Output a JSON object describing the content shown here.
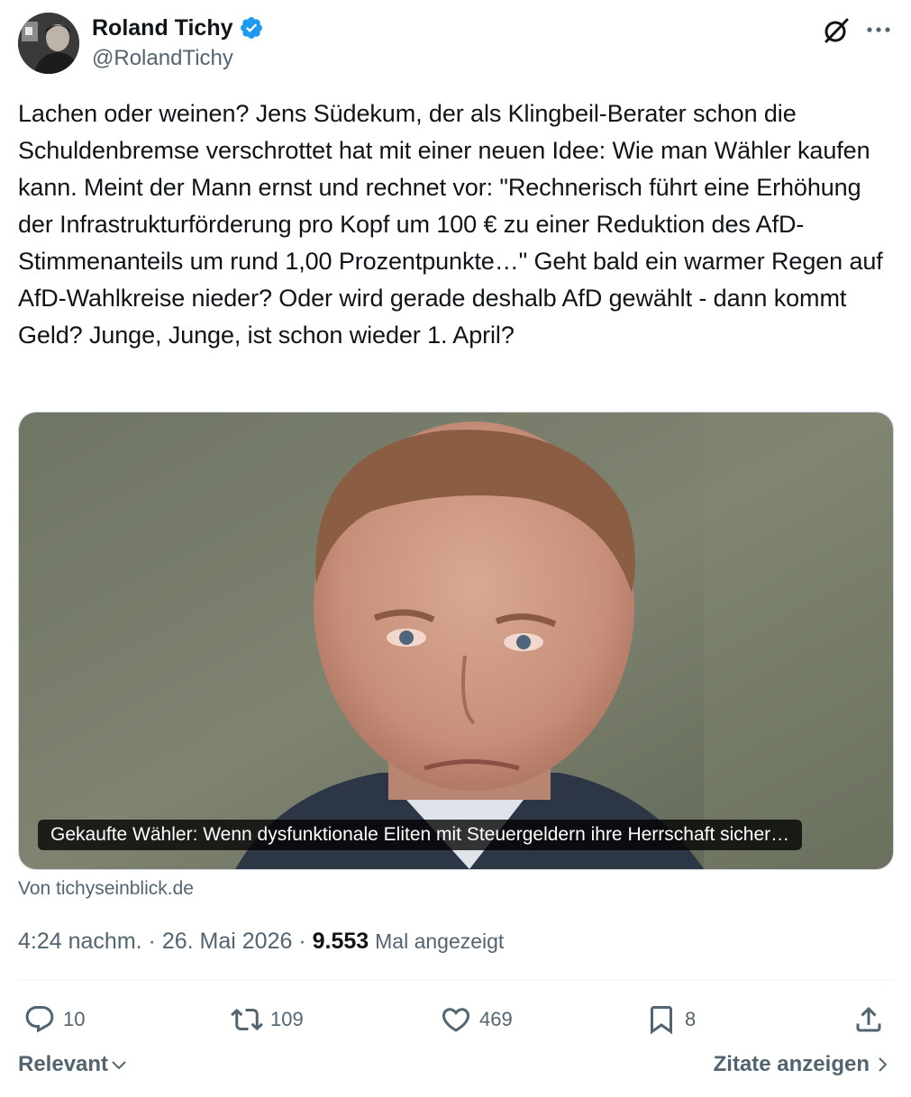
{
  "author": {
    "name": "Roland Tichy",
    "handle": "@RolandTichy",
    "verified_color": "#1d9bf0"
  },
  "tweet": {
    "text": "Lachen oder weinen? Jens Südekum, der als Klingbeil-Berater schon die Schuldenbremse verschrottet hat mit einer neuen Idee: Wie man Wähler kaufen kann. Meint der Mann ernst und rechnet vor: \"Rechnerisch führt eine Erhöhung der Infrastrukturförderung pro Kopf um 100 € zu einer Reduktion des AfD-Stimmenanteils um rund 1,00 Prozentpunkte…\"  Geht bald ein warmer Regen auf AfD-Wahlkreise nieder? Oder wird gerade deshalb AfD gewählt - dann kommt Geld? Junge, Junge, ist schon wieder 1. April?"
  },
  "card": {
    "caption": "Gekaufte Wähler: Wenn dysfunktionale Eliten mit Steuergeldern ihre Herrschaft sicher…",
    "source": "Von tichyseinblick.de"
  },
  "meta": {
    "time": "4:24 nachm.",
    "separator": "·",
    "date": "26. Mai 2026",
    "views_count": "9.553",
    "views_label": "Mal angezeigt"
  },
  "actions": {
    "replies": "10",
    "reposts": "109",
    "likes": "469",
    "bookmarks": "8"
  },
  "footer": {
    "sort_label": "Relevant",
    "quotes_label": "Zitate anzeigen"
  },
  "icons": [
    "grok-icon",
    "more-icon",
    "reply-icon",
    "repost-icon",
    "like-icon",
    "bookmark-icon",
    "share-icon",
    "chevron-down-icon",
    "chevron-right-icon",
    "verified-badge-icon"
  ],
  "colors": {
    "text": "#0f1419",
    "secondary": "#536471",
    "verified": "#1d9bf0",
    "divider": "#eff3f4"
  }
}
